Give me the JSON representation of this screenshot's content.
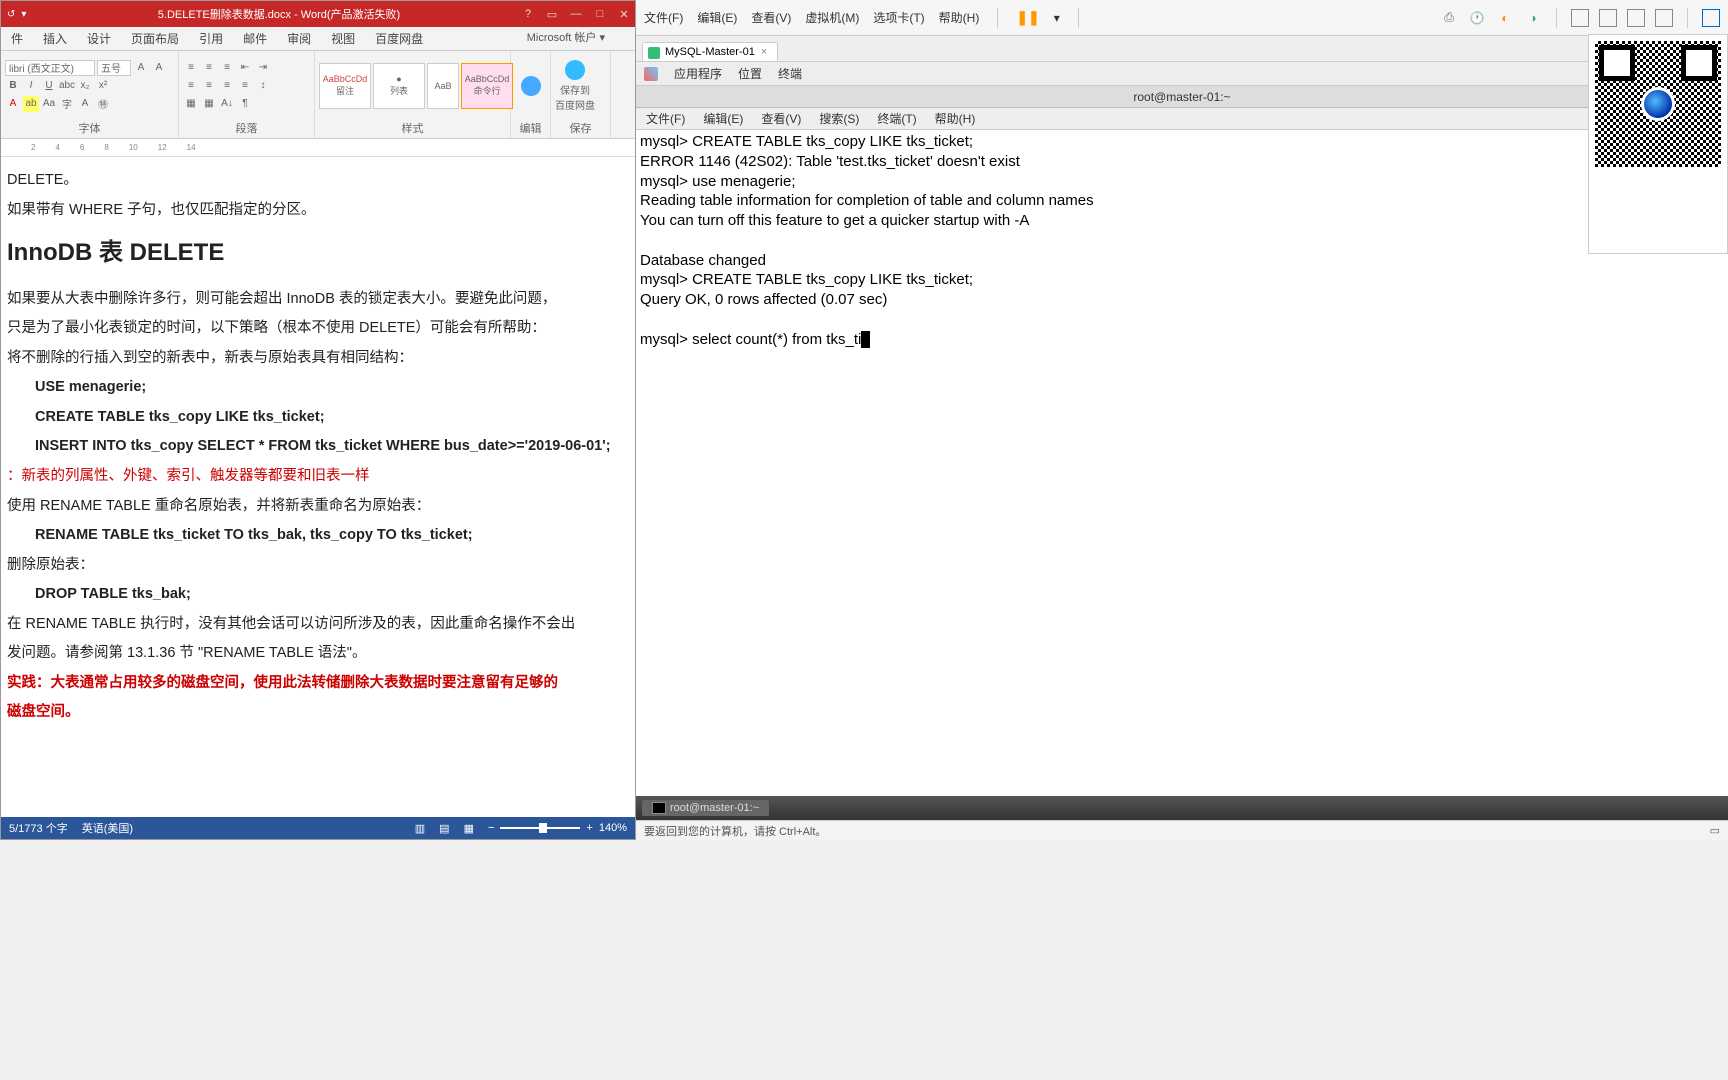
{
  "word": {
    "title": "5.DELETE删除表数据.docx - Word(产品激活失败)",
    "tabs": [
      "件",
      "插入",
      "设计",
      "页面布局",
      "引用",
      "邮件",
      "审阅",
      "视图",
      "百度网盘"
    ],
    "ms_account": "Microsoft 帐户 ▾",
    "font_name": "libri (西文正文)",
    "font_size": "五号",
    "ribbon_groups": {
      "font": "字体",
      "para": "段落",
      "styles": "样式",
      "edit": "编辑",
      "save": "保存"
    },
    "styles": [
      {
        "sample": "AaBbCcDd",
        "name": "留注"
      },
      {
        "sample": "●",
        "name": "列表"
      },
      {
        "sample": "AaB",
        "name": ""
      },
      {
        "sample": "AaBbCcDd",
        "name": "命令行"
      }
    ],
    "save_cloud": "保存到\n百度网盘",
    "doc": {
      "l1": "DELETE。",
      "l2": "如果带有 WHERE 子句，也仅匹配指定的分区。",
      "h2": "InnoDB 表 DELETE",
      "l3": "如果要从大表中删除许多行，则可能会超出 InnoDB 表的锁定表大小。要避免此问题，",
      "l4": "只是为了最小化表锁定的时间，以下策略（根本不使用 DELETE）可能会有所帮助：",
      "l5": "将不删除的行插入到空的新表中，新表与原始表具有相同结构：",
      "c1": "USE menagerie;",
      "c2": "CREATE TABLE tks_copy LIKE tks_ticket;",
      "c3": "INSERT INTO tks_copy SELECT * FROM tks_ticket WHERE bus_date>='2019-06-01';",
      "r1": "：新表的列属性、外键、索引、触发器等都要和旧表一样",
      "l6": "使用 RENAME TABLE 重命名原始表，并将新表重命名为原始表：",
      "c4": "RENAME TABLE tks_ticket TO tks_bak, tks_copy TO tks_ticket;",
      "l7": "删除原始表：",
      "c5": "DROP TABLE tks_bak;",
      "l8": "在 RENAME TABLE 执行时，没有其他会话可以访问所涉及的表，因此重命名操作不会出",
      "l9": "发问题。请参阅第 13.1.36 节 \"RENAME TABLE 语法\"。",
      "r2": "实践：大表通常占用较多的磁盘空间，使用此法转储删除大表数据时要注意留有足够的",
      "r3": "磁盘空间。"
    },
    "status": {
      "pages": "5/1773 个字",
      "lang": "英语(美国)",
      "zoom": "140%"
    }
  },
  "vm": {
    "menus": [
      "文件(F)",
      "编辑(E)",
      "查看(V)",
      "虚拟机(M)",
      "选项卡(T)",
      "帮助(H)"
    ],
    "tab": "MySQL-Master-01",
    "guest_tabs": [
      "应用程序",
      "位置",
      "终端"
    ],
    "term_title": "root@master-01:~",
    "term_menus": [
      "文件(F)",
      "编辑(E)",
      "查看(V)",
      "搜索(S)",
      "终端(T)",
      "帮助(H)"
    ],
    "terminal_text": "mysql> CREATE TABLE tks_copy LIKE tks_ticket;\nERROR 1146 (42S02): Table 'test.tks_ticket' doesn't exist\nmysql> use menagerie;\nReading table information for completion of table and column names\nYou can turn off this feature to get a quicker startup with -A\n\nDatabase changed\nmysql> CREATE TABLE tks_copy LIKE tks_ticket;\nQuery OK, 0 rows affected (0.07 sec)\n\nmysql> select count(*) from tks_ti",
    "taskbar_item": "root@master-01:~",
    "status_hint": "要返回到您的计算机，请按 Ctrl+Alt。"
  }
}
